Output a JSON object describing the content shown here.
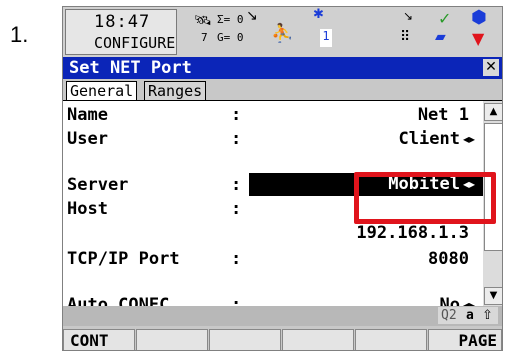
{
  "step_number": "1.",
  "status_bar": {
    "time": "18:47",
    "mode": "CONFIGURE",
    "sat_sum": "Σ= 0",
    "sat_g": "G= 0",
    "sat_count": "7",
    "slot": "1"
  },
  "dialog": {
    "title": "Set NET Port",
    "tabs": [
      "General",
      "Ranges"
    ]
  },
  "fields": {
    "name": {
      "label": "Name",
      "value": "Net 1"
    },
    "user": {
      "label": "User",
      "value": "Client"
    },
    "server": {
      "label": "Server",
      "value": "Mobitel"
    },
    "host": {
      "label": "Host",
      "value": "192.168.1.3"
    },
    "tcpip_port": {
      "label": "TCP/IP Port",
      "value": "8080"
    },
    "auto_conec": {
      "label": "Auto CONEC",
      "value": "No"
    }
  },
  "colon": ":",
  "input_mode": {
    "text": "Q2",
    "case": "a",
    "shift": "⇧"
  },
  "softkeys": {
    "f1": "CONT",
    "f6": "PAGE"
  },
  "colors": {
    "title_bar": "#0b25b8",
    "highlight": "#000000",
    "annotation": "#e0141c"
  }
}
